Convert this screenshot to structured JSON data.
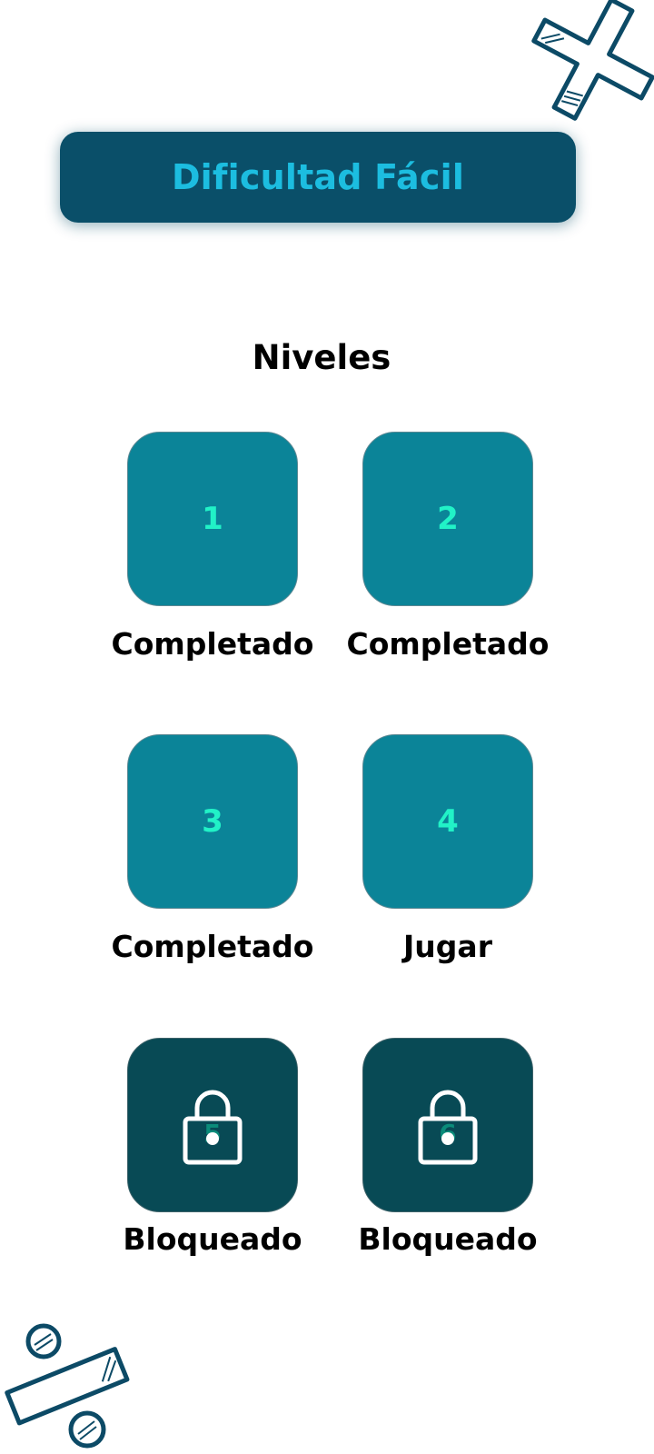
{
  "header": {
    "title": "Dificultad Fácil"
  },
  "levels_section": {
    "title": "Niveles",
    "levels": [
      {
        "number": "1",
        "status": "Completado",
        "locked": false
      },
      {
        "number": "2",
        "status": "Completado",
        "locked": false
      },
      {
        "number": "3",
        "status": "Completado",
        "locked": false
      },
      {
        "number": "4",
        "status": "Jugar",
        "locked": false
      },
      {
        "number": "5",
        "status": "Bloqueado",
        "locked": true
      },
      {
        "number": "6",
        "status": "Bloqueado",
        "locked": true
      }
    ]
  },
  "decorations": {
    "top_right": "multiply-sign-icon",
    "bottom_left": "divide-sign-icon"
  },
  "colors": {
    "banner": "#0a4f69",
    "banner_text": "#1cbde0",
    "tile": "#0b8498",
    "tile_locked": "#084a55",
    "tile_number": "#21f2c7"
  }
}
